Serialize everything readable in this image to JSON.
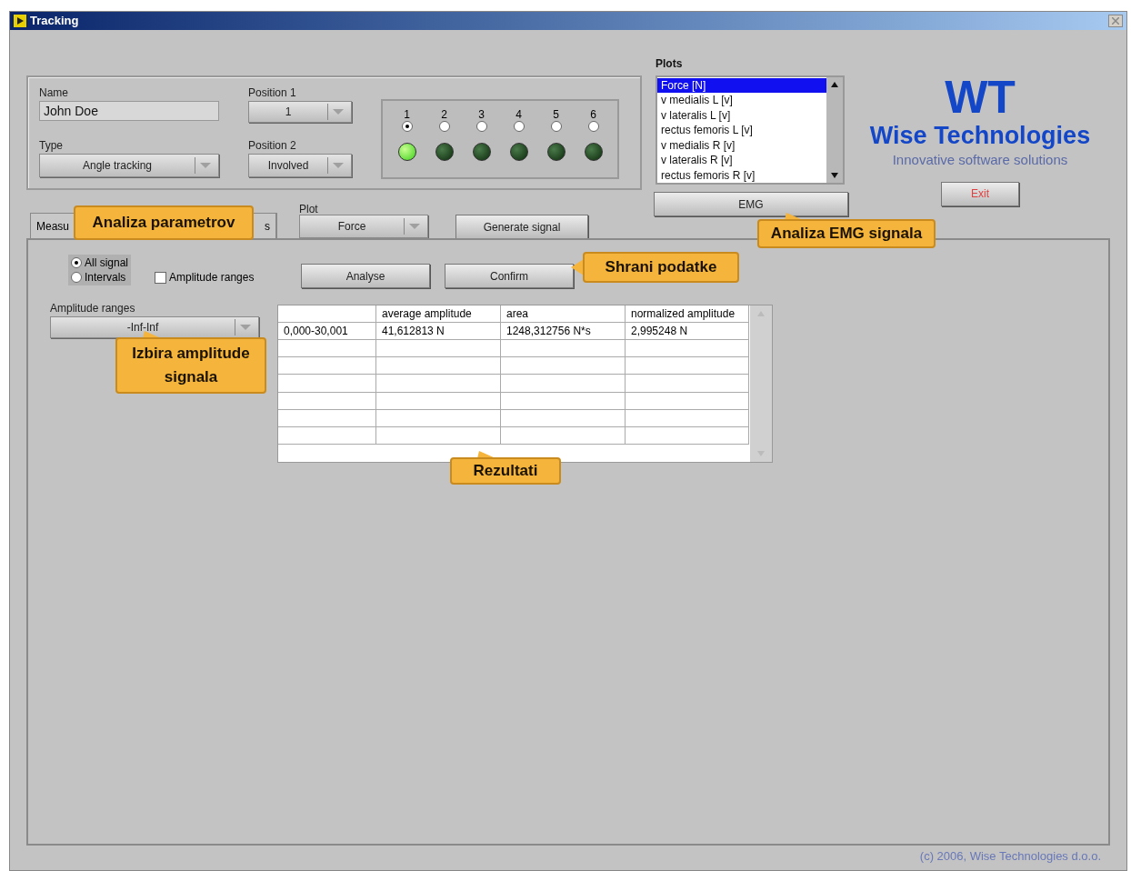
{
  "window": {
    "title": "Tracking"
  },
  "subject": {
    "name_label": "Name",
    "name_value": "John Doe",
    "type_label": "Type",
    "type_value": "Angle tracking",
    "position1_label": "Position 1",
    "position1_value": "1",
    "position2_label": "Position 2",
    "position2_value": "Involved"
  },
  "channels": [
    {
      "label": "1",
      "selected": true,
      "lit": true
    },
    {
      "label": "2",
      "selected": false,
      "lit": false
    },
    {
      "label": "3",
      "selected": false,
      "lit": false
    },
    {
      "label": "4",
      "selected": false,
      "lit": false
    },
    {
      "label": "5",
      "selected": false,
      "lit": false
    },
    {
      "label": "6",
      "selected": false,
      "lit": false
    }
  ],
  "plots": {
    "label": "Plots",
    "items": [
      {
        "text": "Force [N]",
        "selected": true
      },
      {
        "text": "v medialis L [v]",
        "selected": false
      },
      {
        "text": "v lateralis L [v]",
        "selected": false
      },
      {
        "text": "rectus femoris L [v]",
        "selected": false
      },
      {
        "text": "v medialis R [v]",
        "selected": false
      },
      {
        "text": "v lateralis R [v]",
        "selected": false
      },
      {
        "text": "rectus femoris R [v]",
        "selected": false
      }
    ],
    "button": "EMG"
  },
  "logo": {
    "mark": "WT",
    "name": "Wise Technologies",
    "tagline": "Innovative software solutions"
  },
  "exit_button": "Exit",
  "tab": {
    "label_start": "Measu",
    "label_end": "s",
    "selected": true
  },
  "plot_select": {
    "label": "Plot",
    "value": "Force"
  },
  "generate_button": "Generate signal",
  "mode_options": [
    {
      "label": "All signal",
      "selected": true
    },
    {
      "label": "Intervals",
      "selected": false
    }
  ],
  "amplitude_checkbox": {
    "label": "Amplitude ranges",
    "checked": false
  },
  "amplitude_select": {
    "label": "Amplitude ranges",
    "value": "-Inf-Inf"
  },
  "analyse_button": "Analyse",
  "confirm_button": "Confirm",
  "table": {
    "columns": [
      "",
      "average amplitude",
      "area",
      "normalized amplitude"
    ],
    "rows": [
      [
        "0,000-30,001",
        "41,612813 N",
        "1248,312756 N*s",
        "2,995248 N"
      ]
    ]
  },
  "callouts": [
    {
      "text": "Analiza parametrov"
    },
    {
      "text": "Shrani podatke"
    },
    {
      "text": "Analiza EMG signala"
    },
    {
      "text": "Izbira amplitude signala"
    },
    {
      "text": "Rezultati"
    }
  ],
  "footer": "(c) 2006, Wise Technologies d.o.o."
}
